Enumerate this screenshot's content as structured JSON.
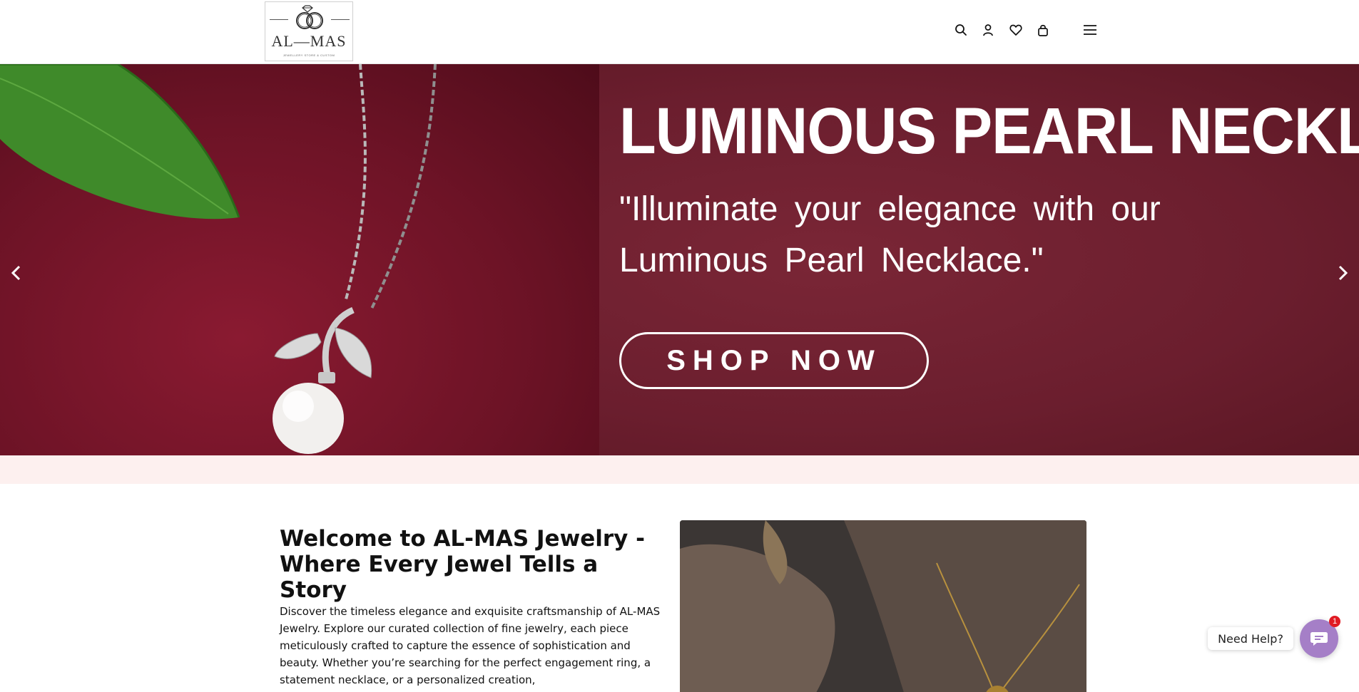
{
  "header": {
    "logo_text": "AL—MAS",
    "logo_tagline": "JEWELLERY STORE & CUSTOM",
    "icons": [
      "search-icon",
      "account-icon",
      "wishlist-heart-icon",
      "cart-bag-icon",
      "hamburger-menu-icon"
    ]
  },
  "hero": {
    "title": "LUMINOUS PEARL NECKLACE",
    "quote": "\"Illuminate your elegance with our Luminous Pearl Necklace.\"",
    "cta_label": "SHOP NOW",
    "prev_icon": "chevron-left-icon",
    "next_icon": "chevron-right-icon",
    "colors": {
      "background": "#6e1f2e",
      "text": "#ffffff"
    }
  },
  "welcome": {
    "title": "Welcome to AL-MAS Jewelry - Where Every Jewel Tells a Story",
    "text": "Discover the timeless elegance and exquisite craftsmanship of AL-MAS Jewelry. Explore our curated collection of fine jewelry, each piece meticulously crafted to capture the essence of sophistication and beauty. Whether you’re searching for the perfect engagement ring, a statement necklace, or a personalized creation,"
  },
  "chat": {
    "label": "Need Help?",
    "badge_count": "1",
    "colors": {
      "button": "#a57fc7",
      "badge": "#e01b24"
    }
  }
}
